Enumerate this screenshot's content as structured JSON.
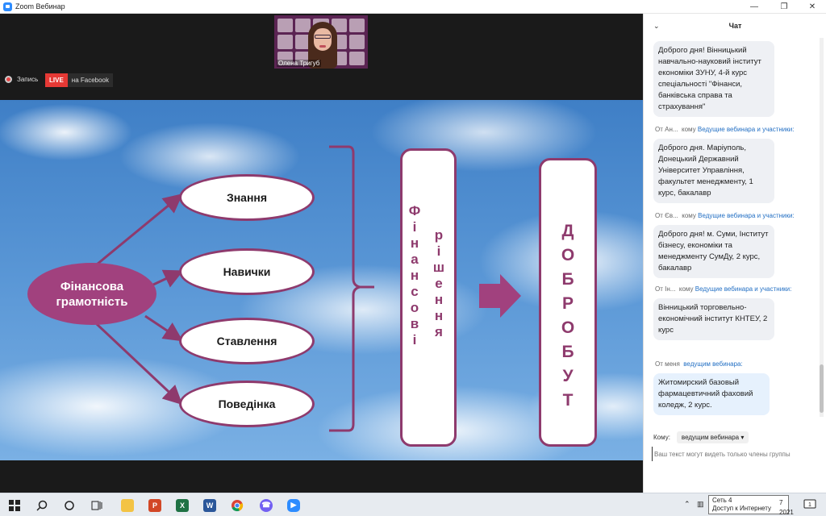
{
  "window": {
    "title": "Zoom Вебинар"
  },
  "video": {
    "participant_name": "Олена Тригуб",
    "record_label": "Запись",
    "live_label": "LIVE",
    "live_target": "на Facebook"
  },
  "slide": {
    "core": "Фінансова грамотність",
    "branches": [
      "Знання",
      "Навички",
      "Ставлення",
      "Поведінка"
    ],
    "box1_col1": [
      "Ф",
      "і",
      "н",
      "а",
      "н",
      "с",
      "о",
      "в",
      "і"
    ],
    "box1_col2": [
      "р",
      "і",
      "ш",
      "е",
      "н",
      "н",
      "я"
    ],
    "box2_letters": [
      "Д",
      "О",
      "Б",
      "Р",
      "О",
      "Б",
      "У",
      "Т"
    ],
    "accent_color": "#8e3a6d"
  },
  "chat": {
    "title": "Чат",
    "messages": [
      {
        "meta": "",
        "text": "Доброго дня! Вінницький навчально-науковий інститут економіки ЗУНУ, 4-й курс спеціальності \"Фінанси, банківська справа та страхування\""
      },
      {
        "meta_from": "От Ан...",
        "meta_mid": "кому",
        "meta_to": "Ведущие вебинара и участники:",
        "text": "Доброго дня. Маріуполь, Донецький Державний Університет Управління, факультет менеджменту, 1 курс, бакалавр"
      },
      {
        "meta_from": "От Єв...",
        "meta_mid": "кому",
        "meta_to": "Ведущие вебинара и участники:",
        "text": "Доброго дня! м. Суми, Інститут бізнесу, економіки та менеджменту СумДу, 2 курс, бакалавр"
      },
      {
        "meta_from": "От Ін...",
        "meta_mid": "кому",
        "meta_to": "Ведущие вебинара и участники:",
        "text": "Вінницький торговельно-економічний інститут КНТЕУ, 2 курс"
      },
      {
        "meta_from": "От меня",
        "meta_mid": "",
        "meta_to": "ведущим вебинара:",
        "text": "Житомирский базовый фармацевтичний фаховий коледж, 2 курс."
      }
    ],
    "recipient_label": "Кому:",
    "recipient_value": "ведущим вебинара",
    "input_placeholder": "Ваш текст могут видеть только члены группы"
  },
  "taskbar": {
    "tooltip_line1": "Сеть 4",
    "tooltip_line2": "Доступ к Интернету",
    "clock_fragment_1": "7",
    "clock_fragment_2": "2021",
    "notifications_count": "1"
  }
}
